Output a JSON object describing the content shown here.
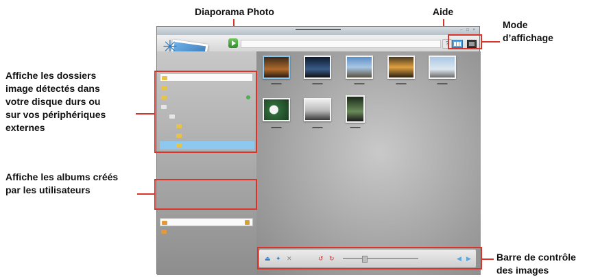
{
  "callouts": {
    "slideshow": "Diaporama Photo",
    "help": "Aide",
    "view_mode_line1": "Mode",
    "view_mode_line2": "d’affichage",
    "folders_line1": "Affiche les dossiers",
    "folders_line2": "image détectés dans",
    "folders_line3": "votre disque durs ou",
    "folders_line4": "sur vos périphériques",
    "folders_line5": "externes",
    "albums_line1": "Affiche les albums créés",
    "albums_line2": "par les utilisateurs",
    "controlbar_line1": "Barre de contrôle",
    "controlbar_line2": "des images"
  },
  "colors": {
    "annotation_red": "#d9332a",
    "selection_blue": "#8cc8f0"
  },
  "icons": {
    "slideshow": "play-arrow-icon",
    "view_thumbnails": "grid-view-icon",
    "view_single": "single-view-icon",
    "album": "album-icon",
    "folder": "folder-icon",
    "control_bar": [
      "import-icon",
      "upload-icon",
      "close-icon",
      "rotate-left-icon",
      "rotate-right-icon",
      "zoom-slider-icon",
      "prev-icon",
      "next-icon"
    ]
  }
}
